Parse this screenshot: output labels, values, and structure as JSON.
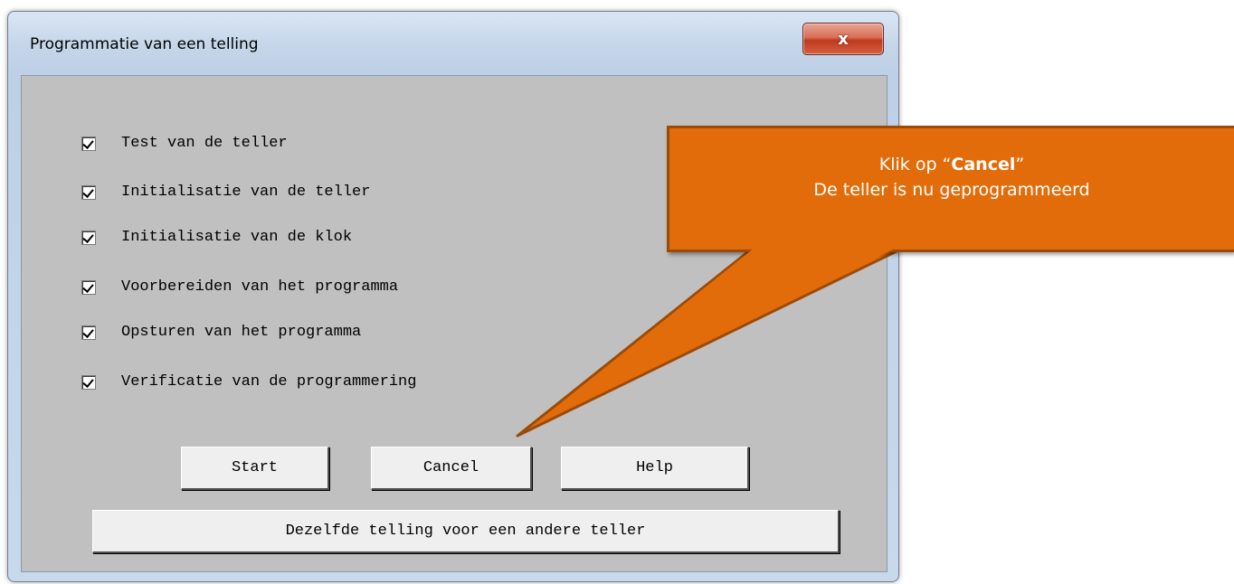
{
  "window": {
    "title": "Programmatie van een telling",
    "close_glyph": "x"
  },
  "checks": [
    {
      "label": "Test van de teller",
      "checked": true
    },
    {
      "label": "Initialisatie van de teller",
      "checked": true
    },
    {
      "label": "Initialisatie van de klok",
      "checked": true
    },
    {
      "label": "Voorbereiden van het programma",
      "checked": true
    },
    {
      "label": "Opsturen van het programma",
      "checked": true
    },
    {
      "label": "Verificatie van de programmering",
      "checked": true
    }
  ],
  "buttons": {
    "start": "Start",
    "cancel": "Cancel",
    "help": "Help",
    "other_counter": "Dezelfde telling voor een andere teller"
  },
  "callout": {
    "line1_prefix": "Klik op “",
    "line1_bold": "Cancel",
    "line1_suffix": "”",
    "line2": "De teller is nu geprogrammeerd",
    "color": "#e36c0a"
  }
}
